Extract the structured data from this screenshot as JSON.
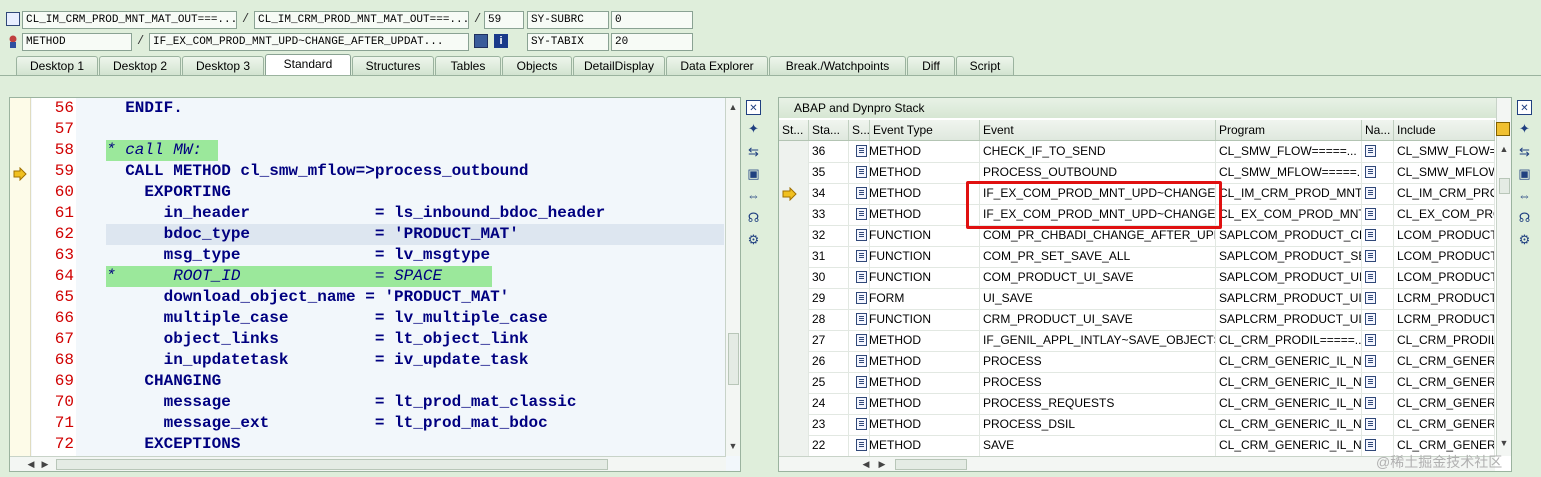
{
  "header": {
    "row1": {
      "field1": "CL_IM_CRM_PROD_MNT_MAT_OUT===...",
      "field2": "CL_IM_CRM_PROD_MNT_MAT_OUT===...",
      "line": "59",
      "sysvar": "SY-SUBRC",
      "sysval": "0"
    },
    "row2": {
      "field1": "METHOD",
      "field2": "IF_EX_COM_PROD_MNT_UPD~CHANGE_AFTER_UPDAT...",
      "sysvar": "SY-TABIX",
      "sysval": "20"
    },
    "separator": "/"
  },
  "tabs": [
    "Desktop 1",
    "Desktop 2",
    "Desktop 3",
    "Standard",
    "Structures",
    "Tables",
    "Objects",
    "DetailDisplay",
    "Data Explorer",
    "Break./Watchpoints",
    "Diff",
    "Script"
  ],
  "active_tab": "Standard",
  "code": [
    {
      "n": "56",
      "t": "  ENDIF."
    },
    {
      "n": "57",
      "t": ""
    },
    {
      "n": "58",
      "t": "* call MW:"
    },
    {
      "n": "59",
      "t": "  CALL METHOD cl_smw_mflow=>process_outbound"
    },
    {
      "n": "60",
      "t": "    EXPORTING"
    },
    {
      "n": "61",
      "t": "      in_header             = ls_inbound_bdoc_header"
    },
    {
      "n": "62",
      "t": "      bdoc_type             = 'PRODUCT_MAT'"
    },
    {
      "n": "63",
      "t": "      msg_type              = lv_msgtype"
    },
    {
      "n": "64",
      "t": "*      ROOT_ID              = SPACE"
    },
    {
      "n": "65",
      "t": "      download_object_name = 'PRODUCT_MAT'"
    },
    {
      "n": "66",
      "t": "      multiple_case         = lv_multiple_case"
    },
    {
      "n": "67",
      "t": "      object_links          = lt_object_link"
    },
    {
      "n": "68",
      "t": "      in_updatetask         = iv_update_task"
    },
    {
      "n": "69",
      "t": "    CHANGING"
    },
    {
      "n": "70",
      "t": "      message               = lt_prod_mat_classic"
    },
    {
      "n": "71",
      "t": "      message_ext           = lt_prod_mat_bdoc"
    },
    {
      "n": "72",
      "t": "    EXCEPTIONS"
    }
  ],
  "stack": {
    "title": "ABAP and Dynpro Stack",
    "columns": [
      "St...",
      "Sta...",
      "S...",
      "Event Type",
      "Event",
      "Program",
      "Na...",
      "Include"
    ],
    "rows": [
      {
        "level": "36",
        "type": "METHOD",
        "event": "CHECK_IF_TO_SEND",
        "program": "CL_SMW_FLOW=====...",
        "include": "CL_SMW_FLOW=====..."
      },
      {
        "level": "35",
        "type": "METHOD",
        "event": "PROCESS_OUTBOUND",
        "program": "CL_SMW_MFLOW=====...",
        "include": "CL_SMW_MFLOW====="
      },
      {
        "level": "34",
        "type": "METHOD",
        "event": "IF_EX_COM_PROD_MNT_UPD~CHANGE_...",
        "program": "CL_IM_CRM_PROD_MNT...",
        "include": "CL_IM_CRM_PROD_"
      },
      {
        "level": "33",
        "type": "METHOD",
        "event": "IF_EX_COM_PROD_MNT_UPD~CHANGE_...",
        "program": "CL_EX_COM_PROD_MNT...",
        "include": "CL_EX_COM_PROD_"
      },
      {
        "level": "32",
        "type": "FUNCTION",
        "event": "COM_PR_CHBADI_CHANGE_AFTER_UPD",
        "program": "SAPLCOM_PRODUCT_CH...",
        "include": "LCOM_PRODUCT_"
      },
      {
        "level": "31",
        "type": "FUNCTION",
        "event": "COM_PR_SET_SAVE_ALL",
        "program": "SAPLCOM_PRODUCT_SET...",
        "include": "LCOM_PRODUCT_"
      },
      {
        "level": "30",
        "type": "FUNCTION",
        "event": "COM_PRODUCT_UI_SAVE",
        "program": "SAPLCOM_PRODUCT_UI...",
        "include": "LCOM_PRODUCT_"
      },
      {
        "level": "29",
        "type": "FORM",
        "event": "UI_SAVE",
        "program": "SAPLCRM_PRODUCT_UI...",
        "include": "LCRM_PRODUCT_"
      },
      {
        "level": "28",
        "type": "FUNCTION",
        "event": "CRM_PRODUCT_UI_SAVE",
        "program": "SAPLCRM_PRODUCT_UI...",
        "include": "LCRM_PRODUCT_"
      },
      {
        "level": "27",
        "type": "METHOD",
        "event": "IF_GENIL_APPL_INTLAY~SAVE_OBJECTS",
        "program": "CL_CRM_PRODIL=====...",
        "include": "CL_CRM_PRODIL="
      },
      {
        "level": "26",
        "type": "METHOD",
        "event": "PROCESS",
        "program": "CL_CRM_GENERIC_IL_NE...",
        "include": "CL_CRM_GENERIC"
      },
      {
        "level": "25",
        "type": "METHOD",
        "event": "PROCESS",
        "program": "CL_CRM_GENERIC_IL_NE...",
        "include": "CL_CRM_GENERIC"
      },
      {
        "level": "24",
        "type": "METHOD",
        "event": "PROCESS_REQUESTS",
        "program": "CL_CRM_GENERIC_IL_NE...",
        "include": "CL_CRM_GENERIC"
      },
      {
        "level": "23",
        "type": "METHOD",
        "event": "PROCESS_DSIL",
        "program": "CL_CRM_GENERIC_IL_NE...",
        "include": "CL_CRM_GENERIC"
      },
      {
        "level": "22",
        "type": "METHOD",
        "event": "SAVE",
        "program": "CL_CRM_GENERIC_IL_NE...",
        "include": "CL_CRM_GENERIC"
      }
    ]
  },
  "watermark": "@稀土掘金技术社区",
  "colors": {
    "accent_red": "#e01010",
    "line_number": "#d00000",
    "keyword": "#8b0066",
    "comment_bg": "#9be89b"
  }
}
